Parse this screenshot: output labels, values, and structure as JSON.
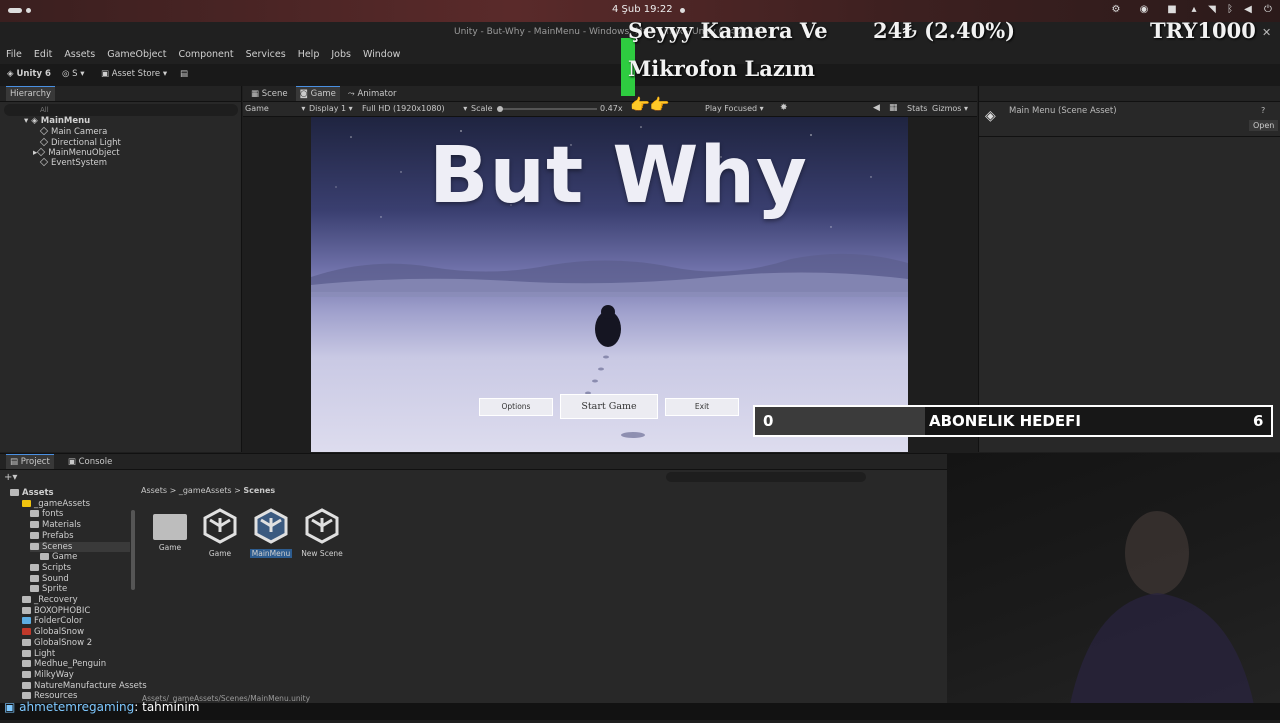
{
  "os": {
    "clock": "4 Şub  19:22"
  },
  "window": {
    "title": "Unity - But-Why - MainMenu - Windows, Mac, Linux - Unity 6 <DX11>"
  },
  "menu": [
    "File",
    "Edit",
    "Assets",
    "GameObject",
    "Component",
    "Services",
    "Help",
    "Jobs",
    "Window"
  ],
  "toolbar": {
    "unity_label": "Unity 6",
    "account_label": "S",
    "asset_store": "Asset Store"
  },
  "hierarchy": {
    "tab": "Hierarchy",
    "search_placeholder": "All",
    "scene": "MainMenu",
    "items": [
      "Main Camera",
      "Directional Light",
      "MainMenuObject",
      "EventSystem"
    ]
  },
  "game_tabs": [
    "Scene",
    "Game",
    "Animator"
  ],
  "game_toolbar": {
    "display_mode": "Game",
    "display": "Display 1",
    "resolution": "Full HD (1920x1080)",
    "scale_label": "Scale",
    "scale_value": "0.47x",
    "play_mode": "Play Focused",
    "stats": "Stats",
    "gizmos": "Gizmos"
  },
  "game": {
    "title": "But Why",
    "buttons": {
      "options": "Options",
      "start": "Start Game",
      "exit": "Exit"
    }
  },
  "inspector": {
    "asset_name": "Main Menu (Scene Asset)",
    "open_label": "Open"
  },
  "project": {
    "tabs": [
      "Project",
      "Console"
    ],
    "breadcrumb": [
      "Assets",
      "_gameAssets",
      "Scenes"
    ],
    "tree": [
      {
        "label": "Assets",
        "level": 0
      },
      {
        "label": "_gameAssets",
        "level": 1
      },
      {
        "label": "fonts",
        "level": 2
      },
      {
        "label": "Materials",
        "level": 2
      },
      {
        "label": "Prefabs",
        "level": 2
      },
      {
        "label": "Scenes",
        "level": 2
      },
      {
        "label": "Game",
        "level": 3
      },
      {
        "label": "Scripts",
        "level": 2
      },
      {
        "label": "Sound",
        "level": 2
      },
      {
        "label": "Sprite",
        "level": 2
      },
      {
        "label": "_Recovery",
        "level": 1
      },
      {
        "label": "BOXOPHOBIC",
        "level": 1
      },
      {
        "label": "FolderColor",
        "level": 1
      },
      {
        "label": "GlobalSnow",
        "level": 1
      },
      {
        "label": "GlobalSnow 2",
        "level": 1
      },
      {
        "label": "Light",
        "level": 1
      },
      {
        "label": "Medhue_Penguin",
        "level": 1
      },
      {
        "label": "MilkyWay",
        "level": 1
      },
      {
        "label": "NatureManufacture Assets",
        "level": 1
      },
      {
        "label": "Resources",
        "level": 1
      }
    ],
    "assets": [
      "Game",
      "Game",
      "MainMenu",
      "New Scene"
    ],
    "footer_path": "Assets/_gameAssets/Scenes/MainMenu.unity"
  },
  "overlay": {
    "donation_line1": "Şeyyy Kamera Ve",
    "donation_line2": "Mikrofon Lazım",
    "donation_amount": "24₺ (2.40%)",
    "donation_goal": "TRY1000",
    "donation_progress": 0.024,
    "sub_goal_current": "0",
    "sub_goal_label": "ABONELIK HEDEFI",
    "sub_goal_target": "6",
    "chat_user": "ahmetemregaming",
    "chat_message": ": tahminim"
  }
}
